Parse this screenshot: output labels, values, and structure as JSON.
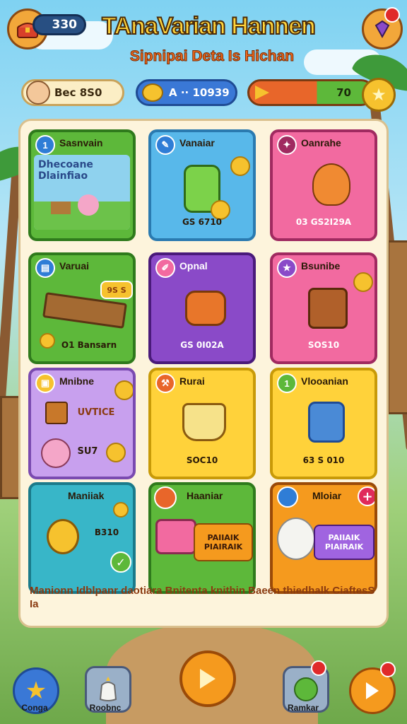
{
  "header": {
    "coins": "330",
    "title": "TAnaVarian Hannen",
    "subtitle": "Sipnipai Deta Is Hichan"
  },
  "resources": {
    "player_label": "Bec 8S0",
    "gold_label": "A ·· 10939",
    "energy_value": "70",
    "energy_fraction": 0.55
  },
  "cards": [
    {
      "title": "Sasnvain",
      "banner": "Dhecoane Dlainfiao",
      "price": ""
    },
    {
      "title": "Vanaiar",
      "banner": "",
      "price": "GS 6710"
    },
    {
      "title": "Oanrahe",
      "banner": "",
      "price": "03 GS2I29A"
    },
    {
      "title": "Varuai",
      "tag": "9S S",
      "price": "O1 Bansarn"
    },
    {
      "title": "Opnal",
      "banner": "",
      "price": "GS 0I02A"
    },
    {
      "title": "Bsunibe",
      "banner": "",
      "price": "SOS10"
    },
    {
      "title": "Mnibne",
      "tag": "UVTICE",
      "tag2": "SU7"
    },
    {
      "title": "Rurai",
      "banner": "",
      "price": "SOC10"
    },
    {
      "title": "Vlooanian",
      "banner": "",
      "price": "63 S 010"
    },
    {
      "title": "Maniiak",
      "tag": "B310"
    },
    {
      "title": "Haaniar",
      "tag": "PAIIAIK PIAIRAIK"
    },
    {
      "title": "Mloiar",
      "tag": "PAIIAIK PIAIRAIK"
    }
  ],
  "footer_note": "Manionn Idblpanr daotiara Bnitenta knithin Baeen thiedhalk CiaftesS Ia",
  "nav": {
    "left_label": "Conga",
    "second_label": "Roobnc",
    "fourth_label": "Ramkar"
  },
  "colors": {
    "green": "#5db83a",
    "blue": "#58b8ea",
    "pink": "#f26aa0",
    "purple": "#8a4ac8",
    "yellow": "#ffd23a",
    "teal": "#38b6c8",
    "orange": "#f59a1e",
    "lavender": "#c8a0ee"
  }
}
